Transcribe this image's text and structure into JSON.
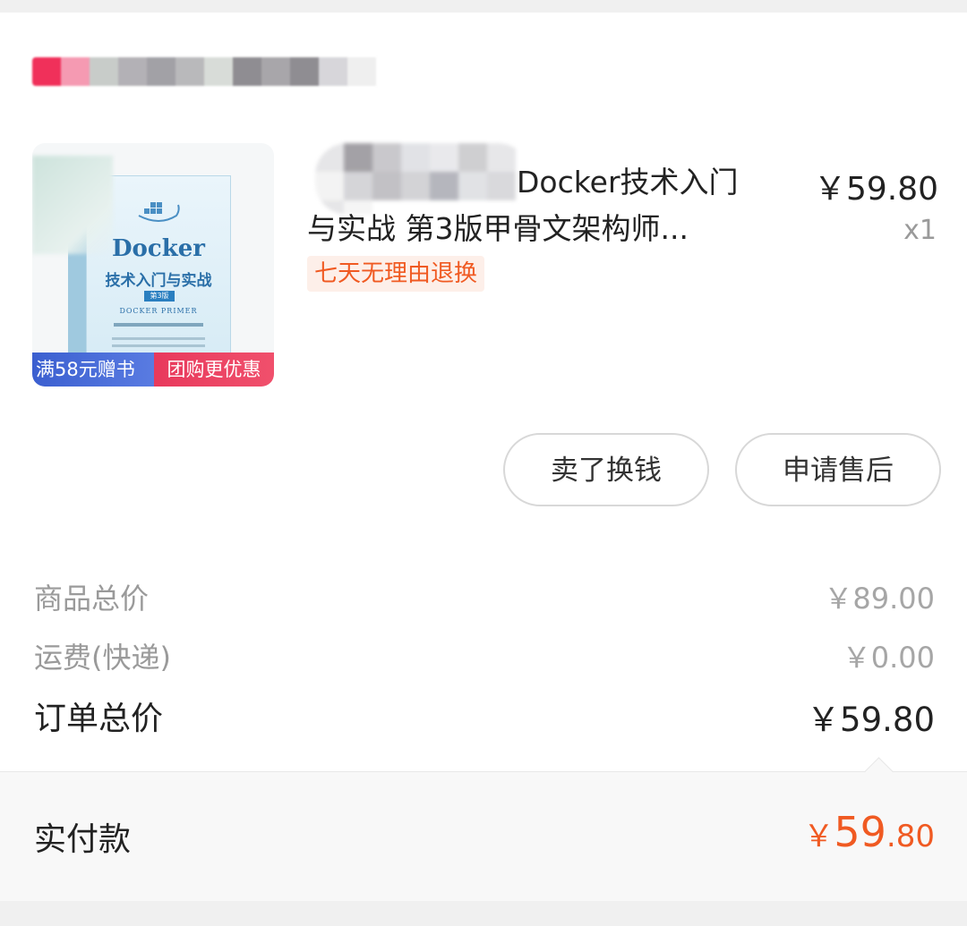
{
  "store": {
    "name": ""
  },
  "product": {
    "title_line1": "Docker技术入门",
    "title_line2": "与实战 第3版甲骨文架构师...",
    "price": "￥59.80",
    "quantity": "x1",
    "badge": "七天无理由退换",
    "image": {
      "book_title_en": "Docker",
      "book_title_cn": "技术入门与实战",
      "edition": "第3版",
      "subtitle": "DOCKER PRIMER",
      "promo_left": "满58元赠书",
      "promo_right": "团购更优惠"
    }
  },
  "actions": {
    "sell_label": "卖了换钱",
    "aftersale_label": "申请售后"
  },
  "summary": {
    "goods_total_label": "商品总价",
    "goods_total_value": "￥89.00",
    "shipping_label": "运费(快递)",
    "shipping_value": "￥0.00",
    "order_total_label": "订单总价",
    "order_total_value": "￥59.80"
  },
  "payment": {
    "label": "实付款",
    "currency": "￥",
    "integer": "59",
    "decimal": ".80"
  },
  "colors": {
    "accent": "#f05a22",
    "badge_bg": "#fdefe9",
    "promo_blue": "#3b5fd0",
    "promo_red": "#e8395c"
  }
}
